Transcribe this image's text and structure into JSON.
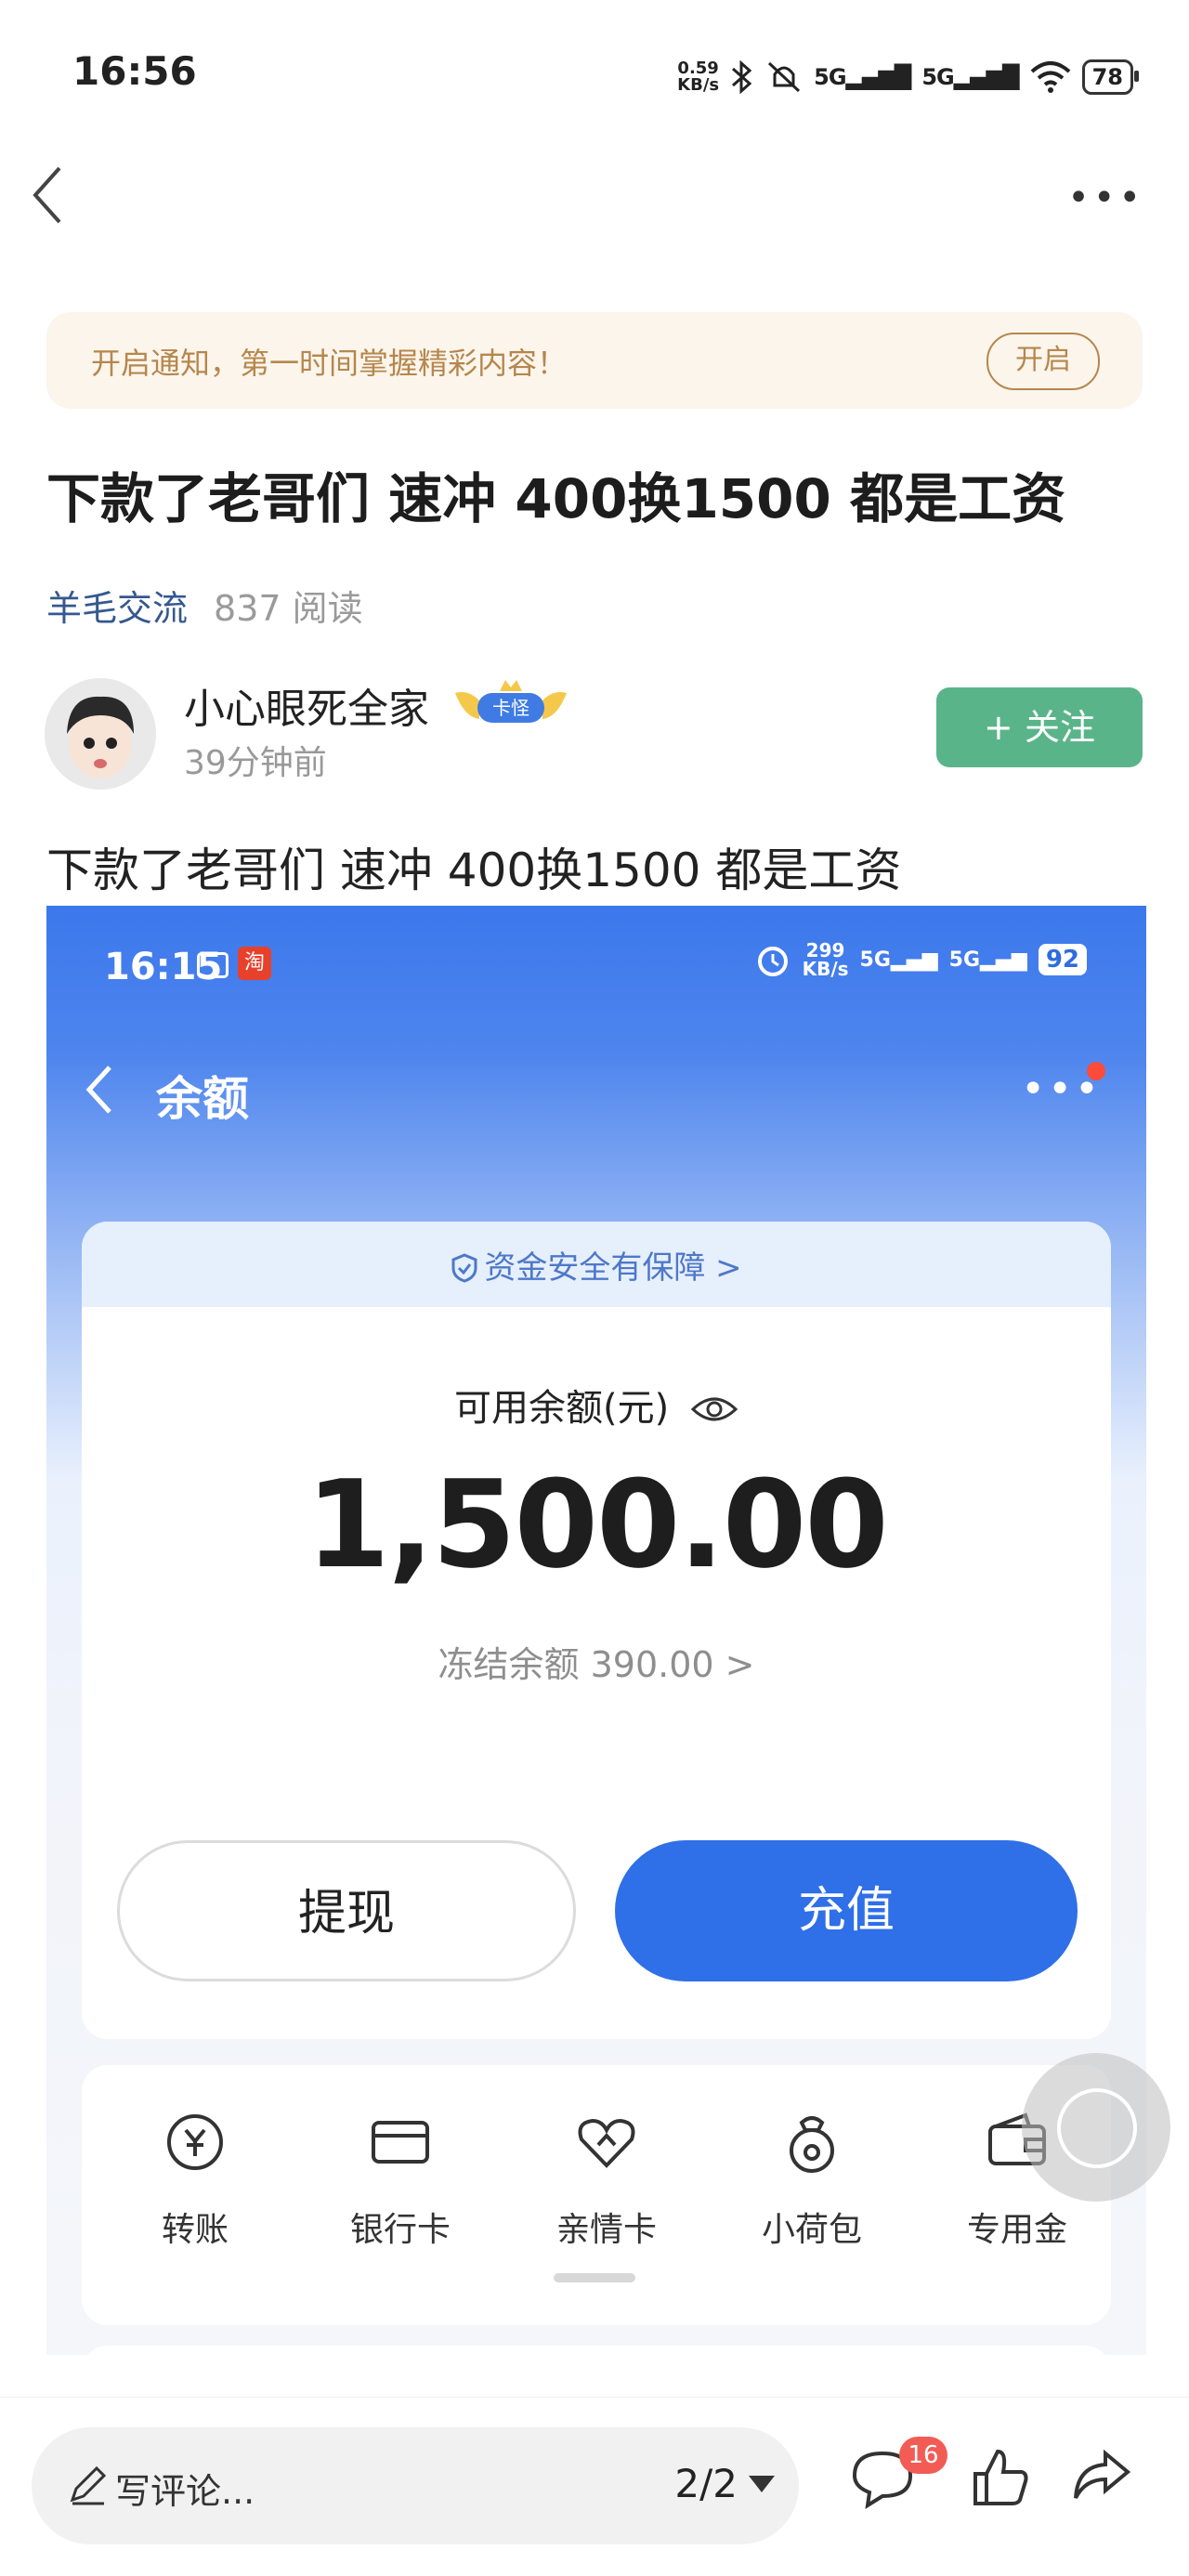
{
  "status_bar": {
    "time": "16:56",
    "net_speed_value": "0.59",
    "net_speed_unit": "KB/s",
    "signal1": "5G",
    "signal2": "5G",
    "battery": "78"
  },
  "notice": {
    "text": "开启通知，第一时间掌握精彩内容！",
    "button": "开启"
  },
  "post": {
    "title": "下款了老哥们 速冲 400换1500 都是工资",
    "category": "羊毛交流",
    "reads": "837 阅读",
    "author": "小心眼死全家",
    "author_badge": "卡怪",
    "time": "39分钟前",
    "follow_label": "+ 关注",
    "body": "下款了老哥们 速冲 400换1500 都是工资"
  },
  "screenshot": {
    "time": "16:15",
    "net_speed_value": "299",
    "net_speed_unit": "KB/s",
    "signal1": "5G",
    "signal2": "5G",
    "battery": "92",
    "page_title": "余额",
    "security_text": "资金安全有保障 >",
    "balance_label": "可用余额(元)",
    "balance_value": "1,500.00",
    "frozen_text": "冻结余额 390.00 >",
    "withdraw_label": "提现",
    "topup_label": "充值",
    "tools": [
      {
        "label": "转账",
        "icon": "transfer-icon"
      },
      {
        "label": "银行卡",
        "icon": "bank-card-icon"
      },
      {
        "label": "亲情卡",
        "icon": "family-card-icon"
      },
      {
        "label": "小荷包",
        "icon": "pouch-icon"
      },
      {
        "label": "专用金",
        "icon": "wallet-icon"
      }
    ]
  },
  "bottom_bar": {
    "comment_placeholder": "写评论...",
    "page_indicator": "2/2",
    "comment_count": "16"
  },
  "colors": {
    "follow_green": "#5ab48a",
    "category_blue": "#35588f",
    "notice_bg": "#fcf5ec",
    "notice_text": "#b5874d",
    "app_blue": "#2f6fe8"
  }
}
